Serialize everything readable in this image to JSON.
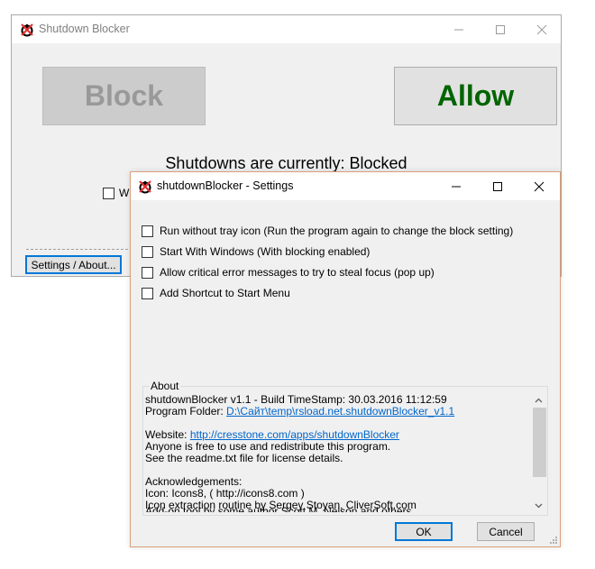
{
  "main_window": {
    "title": "Shutdown Blocker",
    "icon": "shutdown-blocker-app-icon",
    "buttons": {
      "block": "Block",
      "allow": "Allow",
      "settings": "Settings / About..."
    },
    "status_text": "Shutdowns are currently: Blocked",
    "checkbox_partial_label": "Wi",
    "colors": {
      "allow_text": "#006400",
      "block_text": "#999999",
      "block_bg": "#cccccc"
    }
  },
  "settings_dialog": {
    "title": "shutdownBlocker - Settings",
    "options": [
      {
        "label": "Run without tray icon (Run the program again to change the block setting)",
        "checked": false
      },
      {
        "label": "Start With Windows (With blocking enabled)",
        "checked": false
      },
      {
        "label": "Allow critical error messages to try to steal focus (pop up)",
        "checked": false
      },
      {
        "label": "Add Shortcut to Start Menu",
        "checked": false
      }
    ],
    "about": {
      "legend": "About",
      "version_line": "shutdownBlocker v1.1   -   Build TimeStamp: 30.03.2016 11:12:59",
      "folder_label": "Program Folder: ",
      "folder_link": "D:\\Сайт\\temp\\rsload.net.shutdownBlocker_v1.1",
      "website_label": "Website: ",
      "website_link": "http://cresstone.com/apps/shutdownBlocker",
      "license_1": "Anyone is free to use and redistribute this program.",
      "license_2": "See the readme.txt file for license details.",
      "ack_title": "Acknowledgements:",
      "ack_1": "Icon: Icons8, ( http://icons8.com )",
      "ack_2": "Icon extraction routine by Sergey Stoyan, CliverSoft.com",
      "ack_3": "Add-on tool by some author Scott M. Nelson and others"
    },
    "buttons": {
      "ok": "OK",
      "cancel": "Cancel"
    },
    "colors": {
      "border": "#d9a07c",
      "focus": "#0078d7",
      "link": "#0066cc"
    }
  }
}
